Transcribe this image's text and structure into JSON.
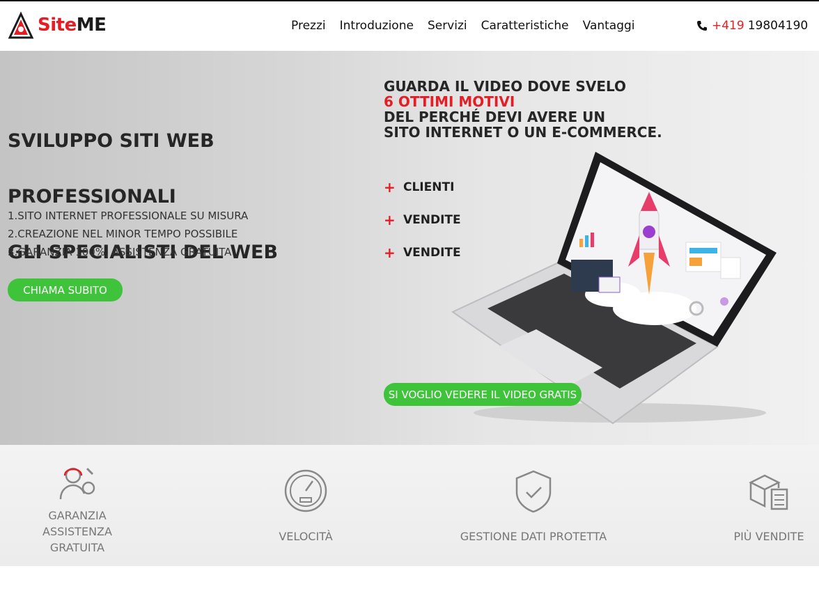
{
  "brand": {
    "site": "Site",
    "me": "ME"
  },
  "nav": {
    "items": [
      "Prezzi",
      "Introduzione",
      "Servizi",
      "Caratteristiche",
      "Vantaggi"
    ]
  },
  "contact": {
    "prefix": "+419",
    "number": "19804190"
  },
  "hero": {
    "title_lines": [
      "SVILUPPO SITI WEB",
      "PROFESSIONALI",
      "GLI SPECIALISTI DEL WEB"
    ],
    "list": [
      "1.SITO INTERNET PROFESSIONALE SU MISURA",
      "2.CREAZIONE NEL MINOR TEMPO POSSIBILE",
      "3.GARANZIA 100%, ASSISTENZA GRATUITA"
    ],
    "cta": "CHIAMA SUBITO"
  },
  "video": {
    "line1": "GUARDA IL VIDEO DOVE SVELO",
    "line2": "6 OTTIMI MOTIVI",
    "line3": "DEL PERCHÉ DEVI AVERE UN",
    "line4": "SITO INTERNET O UN E-COMMERCE.",
    "benefits": [
      "CLIENTI",
      "VENDITE",
      "VENDITE"
    ],
    "cta": "SI VOGLIO VEDERE IL VIDEO GRATIS"
  },
  "features": [
    {
      "label_lines": [
        "GARANZIA ASSISTENZA",
        "GRATUITA"
      ],
      "icon": "support-icon"
    },
    {
      "label_lines": [
        "VELOCITÀ"
      ],
      "icon": "speedometer-icon"
    },
    {
      "label_lines": [
        "GESTIONE DATI PROTETTA"
      ],
      "icon": "shield-icon"
    },
    {
      "label_lines": [
        "PIÙ VENDITE"
      ],
      "icon": "box-checklist-icon"
    }
  ],
  "colors": {
    "brand_red": "#e41e26",
    "cta_green": "#3ec33a"
  }
}
